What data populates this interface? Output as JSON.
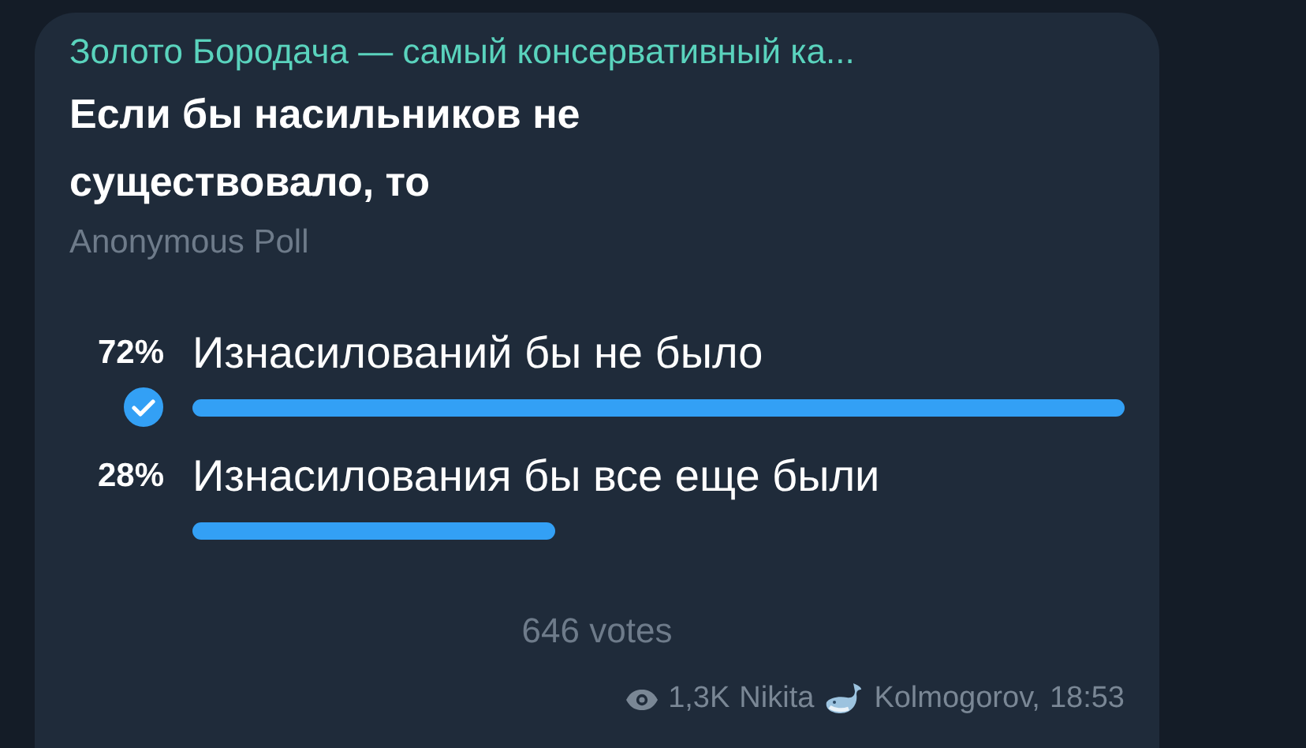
{
  "message": {
    "sender": "Золото Бородача — самый консервативный ка...",
    "question": "Если бы насильников не существовало, то",
    "poll_type": "Anonymous Poll",
    "options": [
      {
        "percent": "72%",
        "label": "Изнасилований бы не было",
        "selected": true
      },
      {
        "percent": "28%",
        "label": "Изнасилования бы все еще были",
        "selected": false
      }
    ],
    "votes": "646 votes",
    "views": "1,3K",
    "author_first": "Nikita",
    "author_last": "Kolmogorov,",
    "time": "18:53"
  }
}
